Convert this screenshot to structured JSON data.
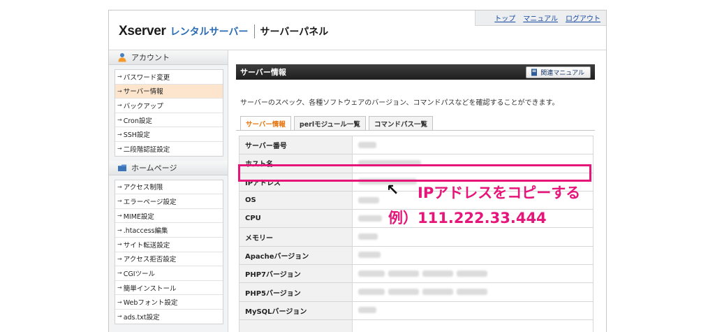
{
  "header": {
    "brand": "Xserver",
    "brand_sub": "レンタルサーバー",
    "panel": "サーバーパネル",
    "links": [
      "トップ",
      "マニュアル",
      "ログアウト"
    ]
  },
  "sidebar": {
    "account": {
      "title": "アカウント",
      "items": [
        "パスワード変更",
        "サーバー情報",
        "バックアップ",
        "Cron設定",
        "SSH設定",
        "二段階認証設定"
      ]
    },
    "homepage": {
      "title": "ホームページ",
      "items": [
        "アクセス制限",
        "エラーページ設定",
        "MIME設定",
        ".htaccess編集",
        "サイト転送設定",
        "アクセス拒否設定",
        "CGIツール",
        "簡単インストール",
        "Webフォント設定",
        "ads.txt設定"
      ]
    },
    "active_item": "サーバー情報"
  },
  "main": {
    "section_title": "サーバー情報",
    "manual_button": "関連マニュアル",
    "description": "サーバーのスペック、各種ソフトウェアのバージョン、コマンドパスなどを確認することができます。",
    "tabs": [
      "サーバー情報",
      "perlモジュール一覧",
      "コマンドパス一覧"
    ],
    "active_tab": "サーバー情報",
    "rows": [
      "サーバー番号",
      "ホスト名",
      "IPアドレス",
      "OS",
      "CPU",
      "メモリー",
      "Apacheバージョン",
      "PHP7バージョン",
      "PHP5バージョン",
      "MySQLバージョン"
    ]
  },
  "annotation": {
    "arrow": "↖",
    "line1": "IPアドレスをコピーする",
    "line2": "例）111.222.33.444"
  },
  "colors": {
    "accent_magenta": "#e6157a",
    "active_tab_text": "#e8730c",
    "active_side_bg": "#fde4cc",
    "brand_blue": "#2a6bb5"
  }
}
